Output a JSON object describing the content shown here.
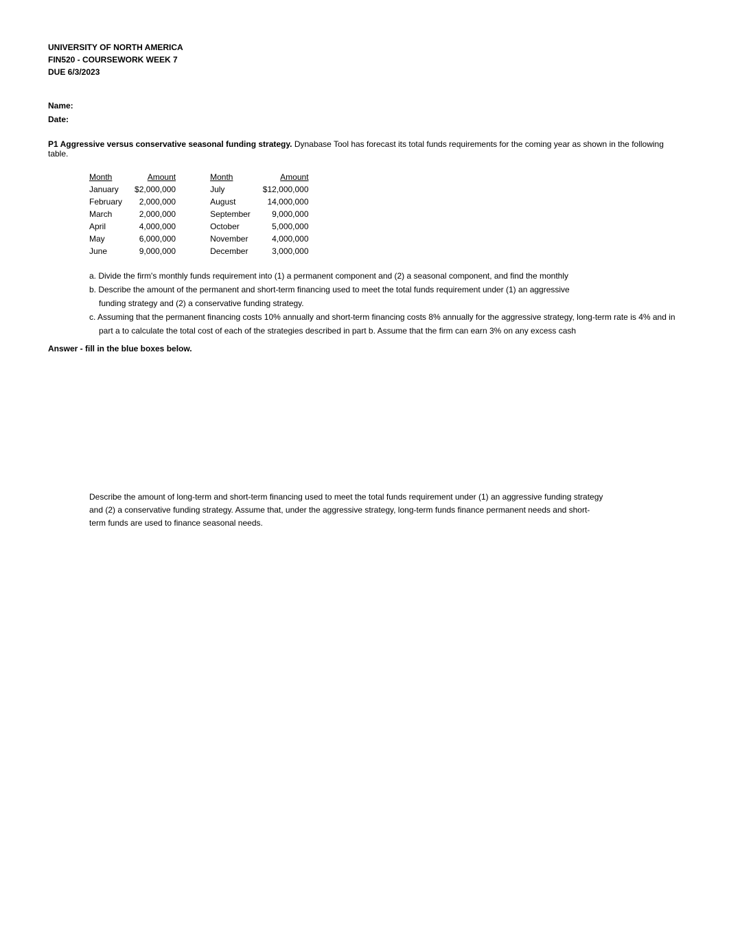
{
  "header": {
    "line1": "UNIVERSITY OF NORTH AMERICA",
    "line2": "FIN520 - COURSEWORK WEEK 7",
    "line3": "DUE 6/3/2023"
  },
  "fields": {
    "name_label": "Name:",
    "date_label": "Date:"
  },
  "problem": {
    "label": "P1  Aggressive versus conservative seasonal funding strategy.",
    "description": " Dynabase Tool has forecast its total funds requirements for the coming year as shown in the following table."
  },
  "table": {
    "headers": [
      "Month",
      "Amount",
      "Month",
      "Amount"
    ],
    "rows": [
      [
        "January",
        "$2,000,000",
        "July",
        "$12,000,000"
      ],
      [
        "February",
        "2,000,000",
        "August",
        "14,000,000"
      ],
      [
        "March",
        "2,000,000",
        "September",
        "9,000,000"
      ],
      [
        "April",
        "4,000,000",
        "October",
        "5,000,000"
      ],
      [
        "May",
        "6,000,000",
        "November",
        "4,000,000"
      ],
      [
        "June",
        "9,000,000",
        "December",
        "3,000,000"
      ]
    ]
  },
  "questions": {
    "a": "a. Divide the firm's monthly funds requirement into (1) a permanent component and (2) a seasonal component, and find the monthly",
    "b": "b. Describe the amount of the permanent and short-term financing used to meet the total funds requirement under (1) an aggressive",
    "b2": "funding strategy and (2) a conservative funding strategy.",
    "c": "c. Assuming that the permanent financing costs 10% annually and short-term financing costs 8% annually for the aggressive strategy, long-term rate is 4% and in",
    "c2": "part a to calculate the total cost of each of the strategies described in part b. Assume that the firm can earn 3% on any excess cash"
  },
  "answer_label": "Answer - fill in the blue boxes below.",
  "description": {
    "text": "Describe the amount of long-term and short-term financing used to meet the total funds requirement under (1) an aggressive funding strategy and (2) a conservative funding strategy. Assume that, under the aggressive strategy, long-term funds finance permanent needs and short-term funds are used to finance seasonal needs."
  }
}
